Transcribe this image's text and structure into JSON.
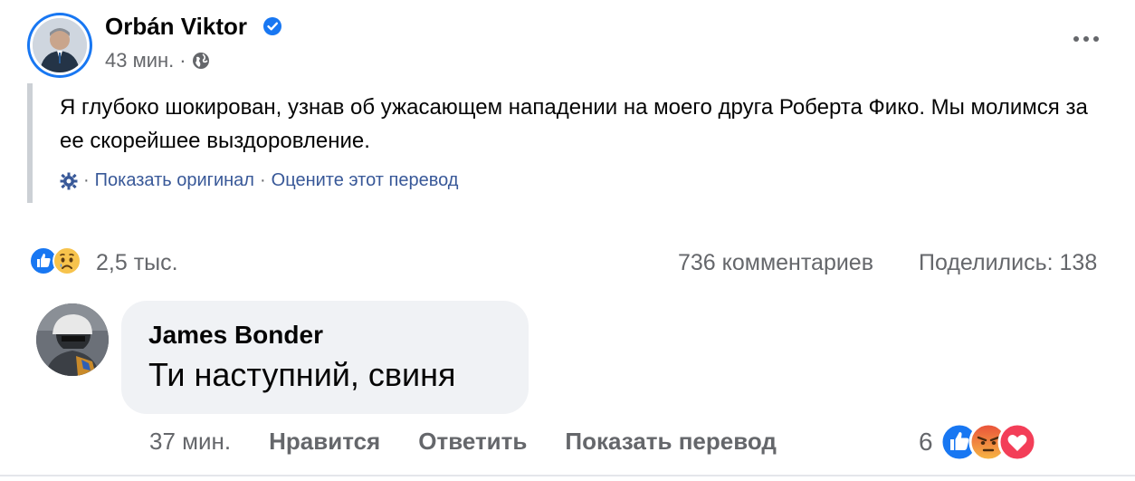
{
  "post": {
    "author": "Orbán Viktor",
    "time": "43 мин.",
    "dot": "·",
    "text": "Я глубоко шокирован, узнав об ужасающем нападении на моего друга Роберта Фико. Мы молимся за ее скорейшее выздоровление.",
    "translation": {
      "dot": "·",
      "show_original": "Показать оригинал",
      "rate": "Оцените этот перевод"
    }
  },
  "stats": {
    "reactions": "2,5 тыс.",
    "comments": "736 комментариев",
    "shares": "Поделились: 138"
  },
  "comment": {
    "author": "James Bonder",
    "text": "Ти наступний, свиня",
    "time": "37 мин.",
    "like": "Нравится",
    "reply": "Ответить",
    "translate": "Показать перевод",
    "reaction_count": "6"
  },
  "icons": {
    "verified": "verified-badge-icon",
    "audience": "globe-icon",
    "more": "more-options-icon",
    "settings": "gear-icon"
  },
  "colors": {
    "brand_blue": "#1877f2",
    "link": "#385898",
    "secondary_text": "#65676b",
    "bubble": "#f0f2f5"
  }
}
